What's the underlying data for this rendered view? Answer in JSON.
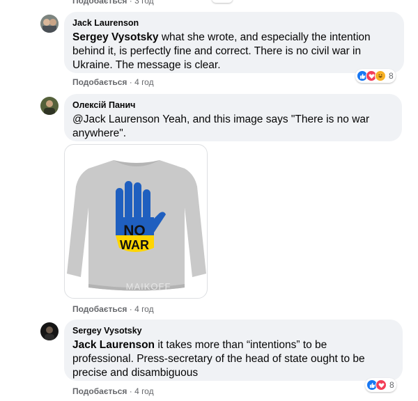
{
  "top_partial": {
    "like_label": "Подобається",
    "time": "3 год"
  },
  "comments": [
    {
      "author": "Jack Laurenson",
      "mention": "Sergey Vysotsky",
      "lines": [
        " what she wrote, and especially the intention",
        "behind it, is perfectly fine and correct. There is no civil war in",
        "Ukraine. The message is clear."
      ],
      "like_label": "Подобається",
      "time": "4 год",
      "reaction_count": "8"
    },
    {
      "author": "Олексій Панич",
      "lines": [
        "@Jack Laurenson Yeah, and this image says \"There is no war",
        "anywhere\"."
      ],
      "like_label": "Подобається",
      "time": "4 год",
      "image": {
        "line1": "NO",
        "line2": "WAR",
        "watermark": "MAIKOFF",
        "colors": {
          "blue": "#1f5fbf",
          "yellow": "#ffd500",
          "sweater": "#c9c9c9"
        }
      }
    },
    {
      "author": "Sergey Vysotsky",
      "mention": "Jack Laurenson",
      "lines": [
        " it takes more than “intentions” to be",
        "professional. Press-secretary of the head of state ought to be",
        "precise and disambiguous"
      ],
      "like_label": "Подобається",
      "time": "4 год",
      "reaction_count": "8"
    }
  ],
  "separator": " · "
}
